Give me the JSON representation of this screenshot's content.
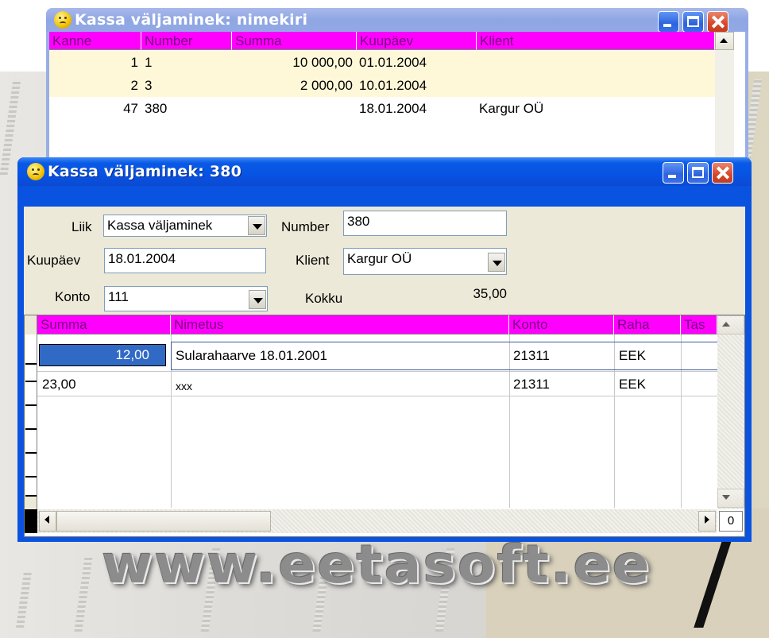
{
  "list_window": {
    "title": "Kassa väljaminek: nimekiri",
    "columns": [
      "Kanne",
      "Number",
      "Summa",
      "Kuupäev",
      "Klient"
    ],
    "rows": [
      {
        "kanne": "1",
        "number": "1",
        "summa": "10 000,00",
        "kuupaev": "01.01.2004",
        "klient": ""
      },
      {
        "kanne": "2",
        "number": "3",
        "summa": "2 000,00",
        "kuupaev": "10.01.2004",
        "klient": ""
      },
      {
        "kanne": "47",
        "number": "380",
        "summa": "",
        "kuupaev": "18.01.2004",
        "klient": "Kargur OÜ"
      }
    ]
  },
  "detail_window": {
    "title": "Kassa väljaminek: 380",
    "form": {
      "liik_label": "Liik",
      "liik_value": "Kassa väljaminek",
      "number_label": "Number",
      "number_value": "380",
      "kuupaev_label": "Kuupäev",
      "kuupaev_value": "18.01.2004",
      "klient_label": "Klient",
      "klient_value": "Kargur OÜ",
      "konto_label": "Konto",
      "konto_value": "111",
      "kokku_label": "Kokku",
      "kokku_value": "35,00"
    },
    "grid": {
      "columns": [
        "Summa",
        "Nimetus",
        "Konto",
        "Raha",
        "Tas"
      ],
      "rows": [
        {
          "summa": "12,00",
          "nimetus": "Sularahaarve 18.01.2001",
          "konto": "21311",
          "raha": "EEK"
        },
        {
          "summa": "23,00",
          "nimetus": "xxx",
          "konto": "21311",
          "raha": "EEK"
        }
      ],
      "counter": "0"
    }
  },
  "watermark": "www.eetasoft.ee",
  "colors": {
    "header_bg": "#ff00ff",
    "header_text": "#7a0080",
    "selected_row": "#fff8d8",
    "titlebar_active": "#0a5ae6",
    "titlebar_inactive": "#93a9e5"
  }
}
